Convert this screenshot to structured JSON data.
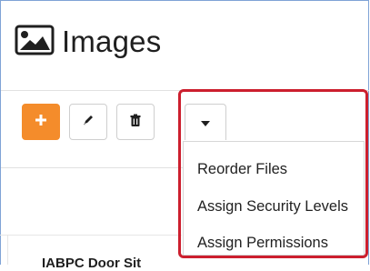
{
  "header": {
    "title": "Images",
    "icon": "image-icon"
  },
  "toolbar": {
    "add_icon": "plus-icon",
    "edit_icon": "pencil-icon",
    "delete_icon": "trash-icon",
    "dropdown_icon": "caret-down-icon",
    "primary_color": "#f48c2b"
  },
  "dropdown_menu": {
    "items": [
      {
        "label": "Reorder Files"
      },
      {
        "label": "Assign Security Levels"
      },
      {
        "label": "Assign Permissions"
      }
    ]
  },
  "list": {
    "partial_row_text": "IABPC Door Sit"
  },
  "highlight_color": "#cc1f2e"
}
